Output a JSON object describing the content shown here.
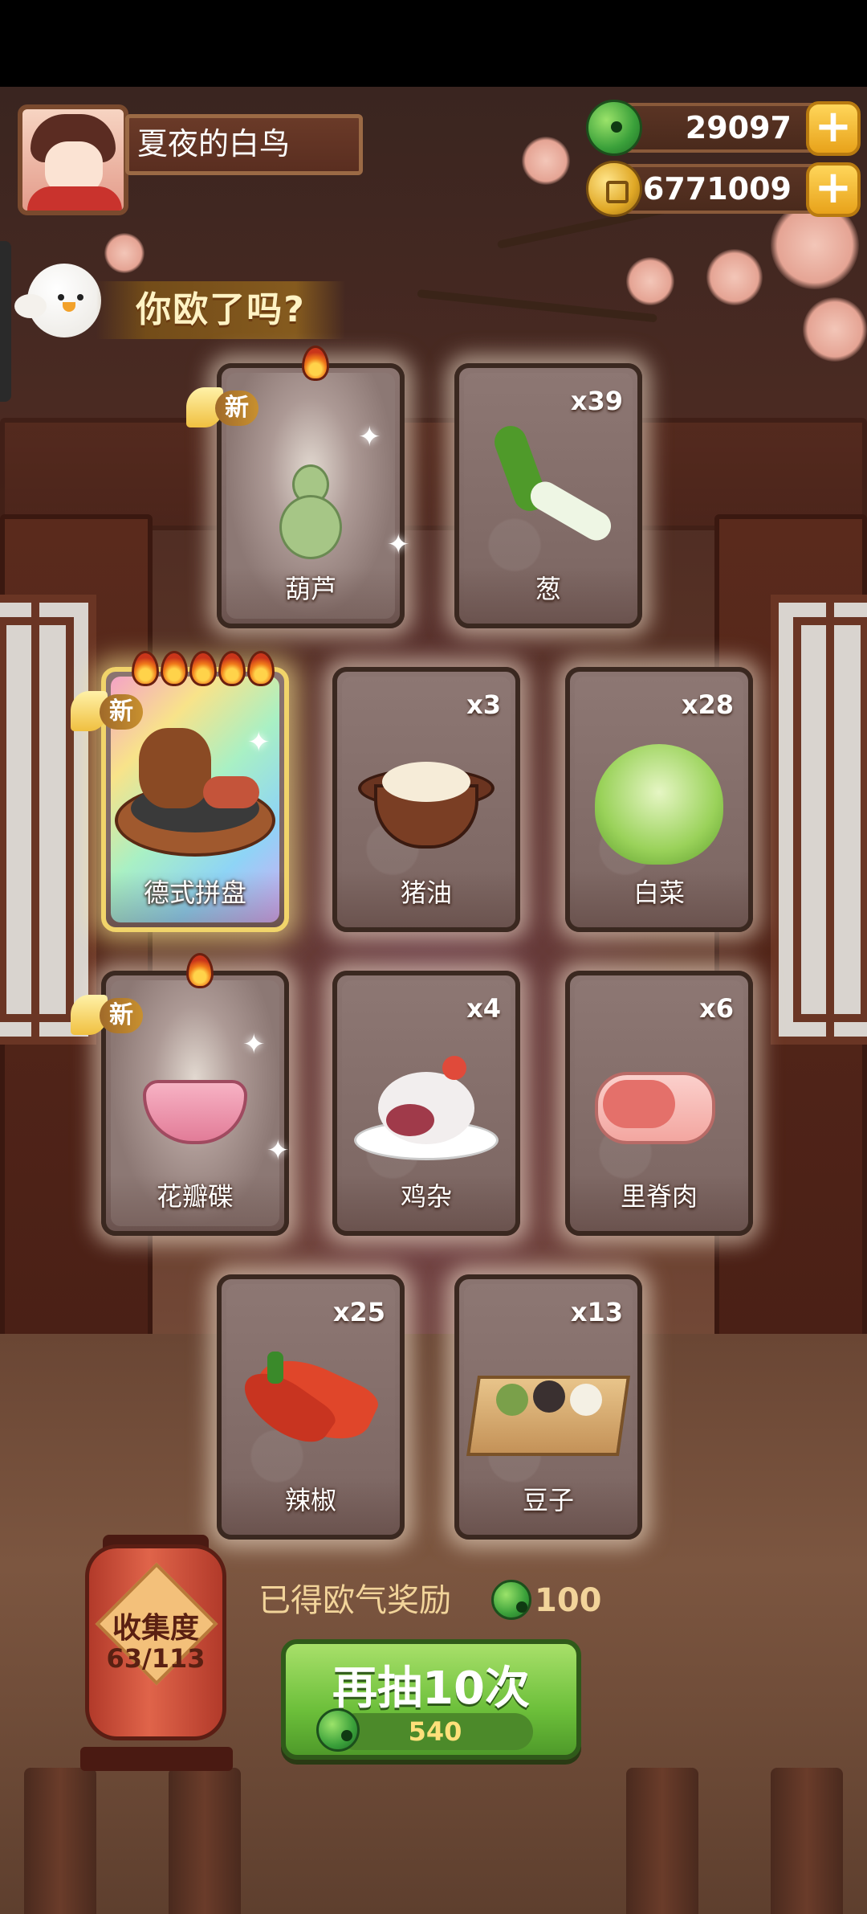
{
  "player": {
    "name": "夏夜的白鸟"
  },
  "currency": {
    "jade": "29097",
    "gold": "6771009"
  },
  "banner": {
    "text": "你欧了吗?"
  },
  "new_label": "新",
  "cards": [
    {
      "name": "葫芦",
      "count": "",
      "is_new": true,
      "stars": 1
    },
    {
      "name": "葱",
      "count": "x39",
      "is_new": false,
      "stars": 0
    },
    {
      "name": "德式拼盘",
      "count": "",
      "is_new": true,
      "stars": 5
    },
    {
      "name": "猪油",
      "count": "x3",
      "is_new": false,
      "stars": 0
    },
    {
      "name": "白菜",
      "count": "x28",
      "is_new": false,
      "stars": 0
    },
    {
      "name": "花瓣碟",
      "count": "",
      "is_new": true,
      "stars": 1
    },
    {
      "name": "鸡杂",
      "count": "x4",
      "is_new": false,
      "stars": 0
    },
    {
      "name": "里脊肉",
      "count": "x6",
      "is_new": false,
      "stars": 0
    },
    {
      "name": "辣椒",
      "count": "x25",
      "is_new": false,
      "stars": 0
    },
    {
      "name": "豆子",
      "count": "x13",
      "is_new": false,
      "stars": 0
    }
  ],
  "collection": {
    "label": "收集度",
    "progress": "63/113"
  },
  "reward": {
    "label": "已得欧气奖励",
    "value": "100"
  },
  "draw": {
    "label": "再抽10次",
    "cost": "540"
  },
  "colors": {
    "jade": "#3aa03a",
    "gold": "#e0a826",
    "button": "#6cbf3a"
  }
}
